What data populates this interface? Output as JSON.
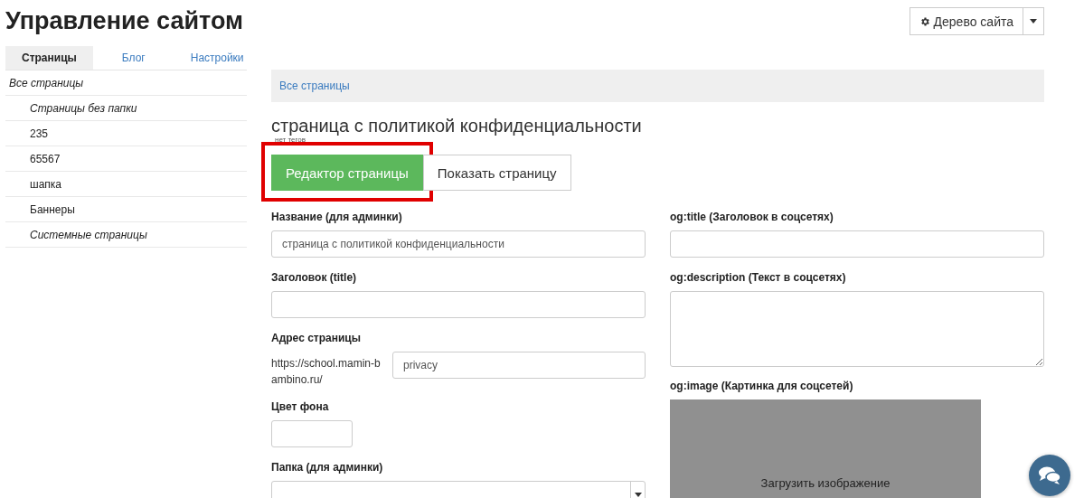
{
  "page_title": "Управление сайтом",
  "site_tree_button": {
    "label": "Дерево сайта"
  },
  "tabs": [
    {
      "label": "Страницы",
      "selected": true
    },
    {
      "label": "Блог",
      "selected": false
    },
    {
      "label": "Настройки",
      "selected": false
    }
  ],
  "sidebar": {
    "items": [
      {
        "label": "Все страницы",
        "kind": "folder",
        "children": [
          {
            "label": "Страницы без папки",
            "kind": "folder"
          },
          {
            "label": "235",
            "kind": "page"
          },
          {
            "label": "65567",
            "kind": "page"
          },
          {
            "label": "шапка",
            "kind": "page"
          },
          {
            "label": "Баннеры",
            "kind": "page"
          },
          {
            "label": "Системные страницы",
            "kind": "folder"
          }
        ]
      }
    ]
  },
  "breadcrumb": "Все страницы",
  "heading": "страница с политикой конфиденциальности",
  "tags_note": "нет тегов",
  "actions": [
    {
      "label": "Редактор страницы",
      "kind": "primary",
      "highlighted": true
    },
    {
      "label": "Показать страницу",
      "kind": "default",
      "highlighted": false
    }
  ],
  "left_fields": [
    {
      "kind": "text",
      "label": "Название (для админки)",
      "value": "страница с политикой конфиденциальности"
    },
    {
      "kind": "text",
      "label": "Заголовок (title)"
    },
    {
      "kind": "address",
      "label": "Адрес страницы",
      "prefix": "https://school.mamin-bambino.ru/",
      "value": "privacy"
    },
    {
      "kind": "color",
      "label": "Цвет фона"
    },
    {
      "kind": "select",
      "label": "Папка (для админки)"
    }
  ],
  "right_fields": [
    {
      "kind": "text",
      "label": "og:title (Заголовок в соцсетях)"
    },
    {
      "kind": "textarea",
      "label": "og:description (Текст в соцсетях)"
    },
    {
      "kind": "image",
      "label": "og:image (Картинка для соцсетей)",
      "button": "Загрузить изображение"
    }
  ]
}
